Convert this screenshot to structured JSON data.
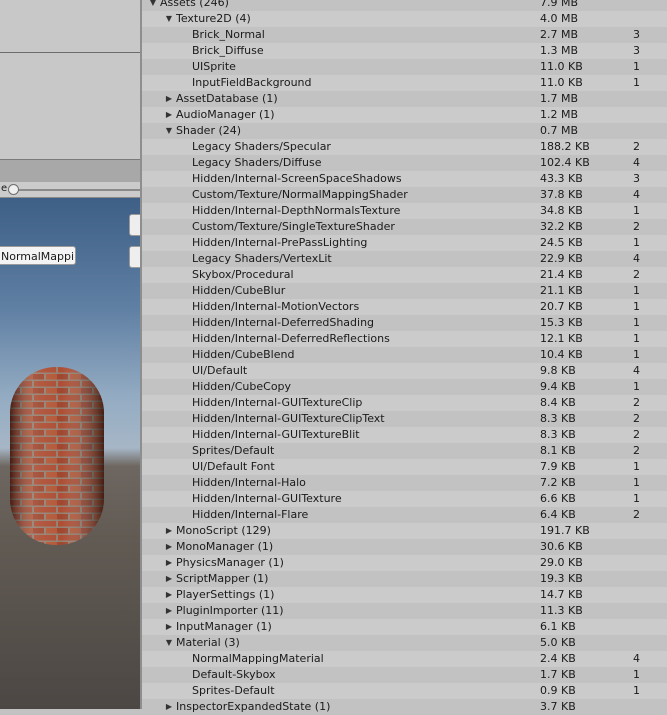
{
  "scene": {
    "scale_label": "e",
    "shader_dropdown": "NormalMappi"
  },
  "tree": [
    {
      "depth": 0,
      "arrow": "down",
      "name": "Assets (246)",
      "mem": "7.9 MB",
      "refs": ""
    },
    {
      "depth": 1,
      "arrow": "down",
      "name": "Texture2D (4)",
      "mem": "4.0 MB",
      "refs": ""
    },
    {
      "depth": 2,
      "arrow": "",
      "name": "Brick_Normal",
      "mem": "2.7 MB",
      "refs": "3"
    },
    {
      "depth": 2,
      "arrow": "",
      "name": "Brick_Diffuse",
      "mem": "1.3 MB",
      "refs": "3"
    },
    {
      "depth": 2,
      "arrow": "",
      "name": "UISprite",
      "mem": "11.0 KB",
      "refs": "1"
    },
    {
      "depth": 2,
      "arrow": "",
      "name": "InputFieldBackground",
      "mem": "11.0 KB",
      "refs": "1"
    },
    {
      "depth": 1,
      "arrow": "right",
      "name": "AssetDatabase (1)",
      "mem": "1.7 MB",
      "refs": ""
    },
    {
      "depth": 1,
      "arrow": "right",
      "name": "AudioManager (1)",
      "mem": "1.2 MB",
      "refs": ""
    },
    {
      "depth": 1,
      "arrow": "down",
      "name": "Shader (24)",
      "mem": "0.7 MB",
      "refs": ""
    },
    {
      "depth": 2,
      "arrow": "",
      "name": "Legacy Shaders/Specular",
      "mem": "188.2 KB",
      "refs": "2"
    },
    {
      "depth": 2,
      "arrow": "",
      "name": "Legacy Shaders/Diffuse",
      "mem": "102.4 KB",
      "refs": "4"
    },
    {
      "depth": 2,
      "arrow": "",
      "name": "Hidden/Internal-ScreenSpaceShadows",
      "mem": "43.3 KB",
      "refs": "3"
    },
    {
      "depth": 2,
      "arrow": "",
      "name": "Custom/Texture/NormalMappingShader",
      "mem": "37.8 KB",
      "refs": "4"
    },
    {
      "depth": 2,
      "arrow": "",
      "name": "Hidden/Internal-DepthNormalsTexture",
      "mem": "34.8 KB",
      "refs": "1"
    },
    {
      "depth": 2,
      "arrow": "",
      "name": "Custom/Texture/SingleTextureShader",
      "mem": "32.2 KB",
      "refs": "2"
    },
    {
      "depth": 2,
      "arrow": "",
      "name": "Hidden/Internal-PrePassLighting",
      "mem": "24.5 KB",
      "refs": "1"
    },
    {
      "depth": 2,
      "arrow": "",
      "name": "Legacy Shaders/VertexLit",
      "mem": "22.9 KB",
      "refs": "4"
    },
    {
      "depth": 2,
      "arrow": "",
      "name": "Skybox/Procedural",
      "mem": "21.4 KB",
      "refs": "2"
    },
    {
      "depth": 2,
      "arrow": "",
      "name": "Hidden/CubeBlur",
      "mem": "21.1 KB",
      "refs": "1"
    },
    {
      "depth": 2,
      "arrow": "",
      "name": "Hidden/Internal-MotionVectors",
      "mem": "20.7 KB",
      "refs": "1"
    },
    {
      "depth": 2,
      "arrow": "",
      "name": "Hidden/Internal-DeferredShading",
      "mem": "15.3 KB",
      "refs": "1"
    },
    {
      "depth": 2,
      "arrow": "",
      "name": "Hidden/Internal-DeferredReflections",
      "mem": "12.1 KB",
      "refs": "1"
    },
    {
      "depth": 2,
      "arrow": "",
      "name": "Hidden/CubeBlend",
      "mem": "10.4 KB",
      "refs": "1"
    },
    {
      "depth": 2,
      "arrow": "",
      "name": "UI/Default",
      "mem": "9.8 KB",
      "refs": "4"
    },
    {
      "depth": 2,
      "arrow": "",
      "name": "Hidden/CubeCopy",
      "mem": "9.4 KB",
      "refs": "1"
    },
    {
      "depth": 2,
      "arrow": "",
      "name": "Hidden/Internal-GUITextureClip",
      "mem": "8.4 KB",
      "refs": "2"
    },
    {
      "depth": 2,
      "arrow": "",
      "name": "Hidden/Internal-GUITextureClipText",
      "mem": "8.3 KB",
      "refs": "2"
    },
    {
      "depth": 2,
      "arrow": "",
      "name": "Hidden/Internal-GUITextureBlit",
      "mem": "8.3 KB",
      "refs": "2"
    },
    {
      "depth": 2,
      "arrow": "",
      "name": "Sprites/Default",
      "mem": "8.1 KB",
      "refs": "2"
    },
    {
      "depth": 2,
      "arrow": "",
      "name": "UI/Default Font",
      "mem": "7.9 KB",
      "refs": "1"
    },
    {
      "depth": 2,
      "arrow": "",
      "name": "Hidden/Internal-Halo",
      "mem": "7.2 KB",
      "refs": "1"
    },
    {
      "depth": 2,
      "arrow": "",
      "name": "Hidden/Internal-GUITexture",
      "mem": "6.6 KB",
      "refs": "1"
    },
    {
      "depth": 2,
      "arrow": "",
      "name": "Hidden/Internal-Flare",
      "mem": "6.4 KB",
      "refs": "2"
    },
    {
      "depth": 1,
      "arrow": "right",
      "name": "MonoScript (129)",
      "mem": "191.7 KB",
      "refs": ""
    },
    {
      "depth": 1,
      "arrow": "right",
      "name": "MonoManager (1)",
      "mem": "30.6 KB",
      "refs": ""
    },
    {
      "depth": 1,
      "arrow": "right",
      "name": "PhysicsManager (1)",
      "mem": "29.0 KB",
      "refs": ""
    },
    {
      "depth": 1,
      "arrow": "right",
      "name": "ScriptMapper (1)",
      "mem": "19.3 KB",
      "refs": ""
    },
    {
      "depth": 1,
      "arrow": "right",
      "name": "PlayerSettings (1)",
      "mem": "14.7 KB",
      "refs": ""
    },
    {
      "depth": 1,
      "arrow": "right",
      "name": "PluginImporter (11)",
      "mem": "11.3 KB",
      "refs": ""
    },
    {
      "depth": 1,
      "arrow": "right",
      "name": "InputManager (1)",
      "mem": "6.1 KB",
      "refs": ""
    },
    {
      "depth": 1,
      "arrow": "down",
      "name": "Material (3)",
      "mem": "5.0 KB",
      "refs": ""
    },
    {
      "depth": 2,
      "arrow": "",
      "name": "NormalMappingMaterial",
      "mem": "2.4 KB",
      "refs": "4"
    },
    {
      "depth": 2,
      "arrow": "",
      "name": "Default-Skybox",
      "mem": "1.7 KB",
      "refs": "1"
    },
    {
      "depth": 2,
      "arrow": "",
      "name": "Sprites-Default",
      "mem": "0.9 KB",
      "refs": "1"
    },
    {
      "depth": 1,
      "arrow": "right",
      "name": "InspectorExpandedState (1)",
      "mem": "3.7 KB",
      "refs": ""
    }
  ]
}
